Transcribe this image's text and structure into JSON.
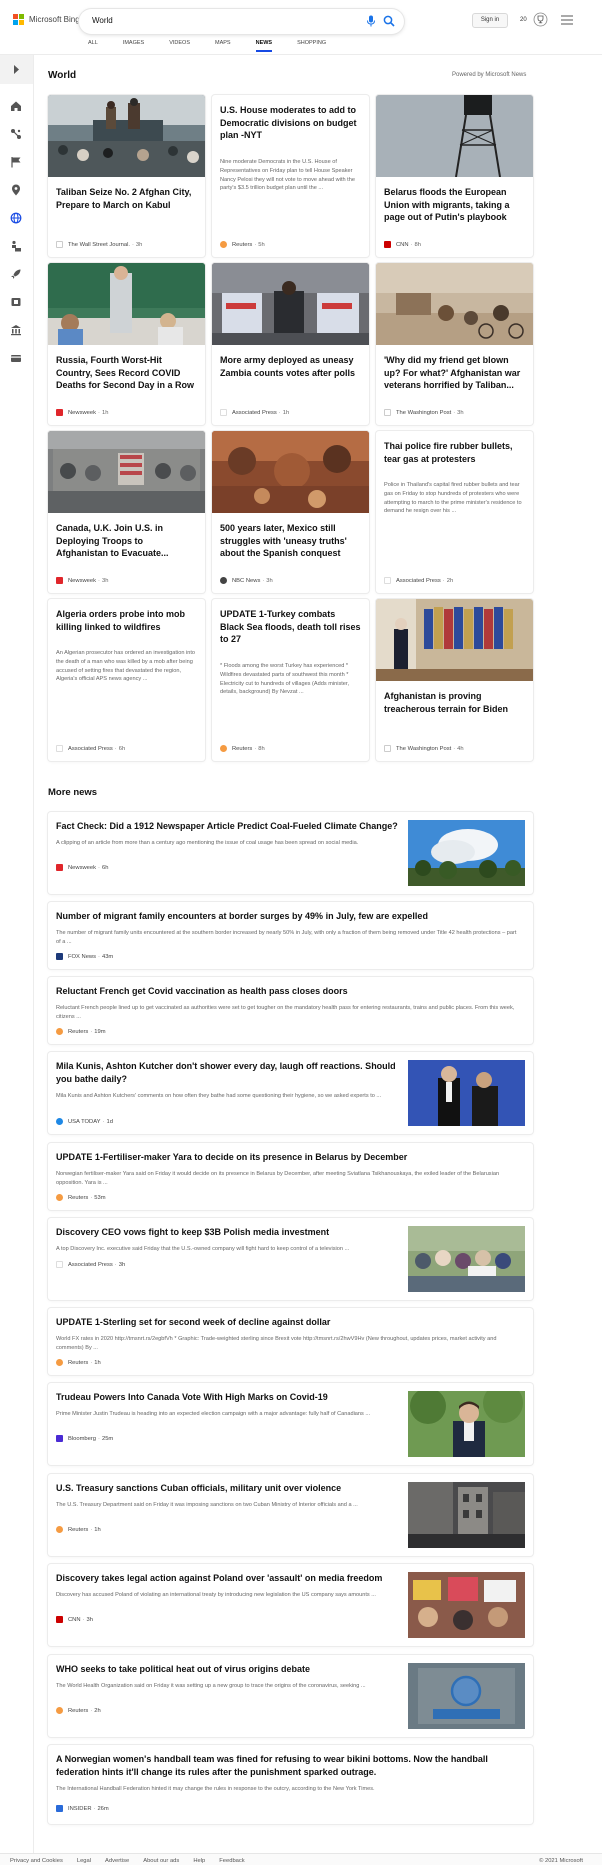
{
  "header": {
    "logo_text": "Microsoft Bing",
    "search_value": "World",
    "signin_label": "Sign in",
    "rewards_count": "20",
    "tabs": [
      {
        "label": "ALL"
      },
      {
        "label": "IMAGES"
      },
      {
        "label": "VIDEOS"
      },
      {
        "label": "MAPS"
      },
      {
        "label": "NEWS"
      },
      {
        "label": "SHOPPING"
      }
    ],
    "active_tab": "NEWS"
  },
  "world": {
    "title": "World",
    "powered_by": "Powered by Microsoft News",
    "cards": [
      {
        "title": "Taliban Seize No. 2 Afghan City, Prepare to March on Kabul",
        "source": "The Wall Street Journal.",
        "time": "3h"
      },
      {
        "title": "U.S. House moderates to add to Democratic divisions on budget plan -NYT",
        "snippet": "Nine moderate Democrats in the U.S. House of Representatives on Friday plan to tell House Speaker Nancy Pelosi they will not vote to move ahead with the party's $3.5 trillion budget plan until the ...",
        "source": "Reuters",
        "time": "5h"
      },
      {
        "title": "Belarus floods the European Union with migrants, taking a page out of Putin's playbook",
        "source": "CNN",
        "time": "8h"
      },
      {
        "title": "Russia, Fourth Worst-Hit Country, Sees Record COVID Deaths for Second Day in a Row",
        "source": "Newsweek",
        "time": "1h"
      },
      {
        "title": "More army deployed as uneasy Zambia counts votes after polls",
        "source": "Associated Press",
        "time": "1h"
      },
      {
        "title": "'Why did my friend get blown up? For what?' Afghanistan war veterans horrified by Taliban...",
        "source": "The Washington Post",
        "time": "3h"
      },
      {
        "title": "Canada, U.K. Join U.S. in Deploying Troops to Afghanistan to Evacuate...",
        "source": "Newsweek",
        "time": "3h"
      },
      {
        "title": "500 years later, Mexico still struggles with 'uneasy truths' about the Spanish conquest",
        "source": "NBC News",
        "time": "3h"
      },
      {
        "title": "Thai police fire rubber bullets, tear gas at protesters",
        "snippet": "Police in Thailand's capital fired rubber bullets and tear gas on Friday to stop hundreds of protesters who were attempting to march to the prime minister's residence to demand he resign over his ...",
        "source": "Associated Press",
        "time": "2h"
      },
      {
        "title": "Algeria orders probe into mob killing linked to wildfires",
        "snippet": "An Algerian prosecutor has ordered an investigation into the death of a man who was killed by a mob after being accused of setting fires that devastated the region, Algeria's official APS news agency ...",
        "source": "Associated Press",
        "time": "6h"
      },
      {
        "title": "UPDATE 1-Turkey combats Black Sea floods, death toll rises to 27",
        "snippet": "* Floods among the worst Turkey has experienced * Wildfires devastated parts of southwest this month * Electricity cut to hundreds of villages (Adds minister, details, background) By Nevzat ...",
        "source": "Reuters",
        "time": "8h"
      },
      {
        "title": "Afghanistan is proving treacherous terrain for Biden",
        "source": "The Washington Post",
        "time": "4h"
      }
    ]
  },
  "more_news": {
    "title": "More news",
    "items": [
      {
        "title": "Fact Check: Did a 1912 Newspaper Article Predict Coal-Fueled Climate Change?",
        "snippet": "A clipping of an article from more than a century ago mentioning the issue of coal usage has been spread on social media.",
        "source": "Newsweek",
        "time": "6h"
      },
      {
        "title": "Number of migrant family encounters at border surges by 49% in July, few are expelled",
        "snippet": "The number of migrant family units encountered at the southern border increased by nearly 50% in July, with only a fraction of them being removed under Title 42 health protections – part of a ...",
        "source": "FOX News",
        "time": "43m"
      },
      {
        "title": "Reluctant French get Covid vaccination as health pass closes doors",
        "snippet": "Reluctant French people lined up to get vaccinated as authorities were set to get tougher on the mandatory health pass for entering restaurants, trains and public places. From this week, citizens ...",
        "source": "Reuters",
        "time": "19m"
      },
      {
        "title": "Mila Kunis, Ashton Kutcher don't shower every day, laugh off reactions. Should you bathe daily?",
        "snippet": "Mila Kunis and Ashton Kutchers' comments on how often they bathe had some questioning their hygiene, so we asked experts to ...",
        "source": "USA TODAY",
        "time": "1d"
      },
      {
        "title": "UPDATE 1-Fertiliser-maker Yara to decide on its presence in Belarus by December",
        "snippet": "Norwegian fertiliser-maker Yara said on Friday it would decide on its presence in Belarus by December, after meeting Sviatlana Tsikhanouskaya, the exiled leader of the Belarusian opposition. Yara is ...",
        "source": "Reuters",
        "time": "53m"
      },
      {
        "title": "Discovery CEO vows fight to keep $3B Polish media investment",
        "snippet": "A top Discovery Inc. executive said Friday that the U.S.-owned company will fight hard to keep control of a television ...",
        "source": "Associated Press",
        "time": "3h"
      },
      {
        "title": "UPDATE 1-Sterling set for second week of decline against dollar",
        "snippet": "World FX rates in 2020 http://tmsnrt.rs/2egbfVh * Graphic: Trade-weighted sterling since Brexit vote http://tmsnrt.rs/2hwV9Hv (New throughout, updates prices, market activity and comments) By ...",
        "source": "Reuters",
        "time": "1h"
      },
      {
        "title": "Trudeau Powers Into Canada Vote With High Marks on Covid-19",
        "snippet": "Prime Minister Justin Trudeau is heading into an expected election campaign with a major advantage: fully half of Canadians ...",
        "source": "Bloomberg",
        "time": "25m"
      },
      {
        "title": "U.S. Treasury sanctions Cuban officials, military unit over violence",
        "snippet": "The U.S. Treasury Department said on Friday it was imposing sanctions on two Cuban Ministry of Interior officials and a ...",
        "source": "Reuters",
        "time": "1h"
      },
      {
        "title": "Discovery takes legal action against Poland over 'assault' on media freedom",
        "snippet": "Discovery has accused Poland of violating an international treaty by introducing new legislation the US company says amounts ...",
        "source": "CNN",
        "time": "3h"
      },
      {
        "title": "WHO seeks to take political heat out of virus origins debate",
        "snippet": "The World Health Organization said on Friday it was setting up a new group to trace the origins of the coronavirus, seeking ...",
        "source": "Reuters",
        "time": "2h"
      },
      {
        "title": "A Norwegian women's handball team was fined for refusing to wear bikini bottoms. Now the handball federation hints it'll change its rules after the punishment sparked outrage.",
        "snippet": "The International Handball Federation hinted it may change the rules in response to the outcry, according to the New York Times.",
        "source": "INSIDER",
        "time": "26m"
      }
    ]
  },
  "footer": {
    "links": [
      "Privacy and Cookies",
      "Legal",
      "Advertise",
      "About our ads",
      "Help",
      "Feedback"
    ],
    "copyright": "© 2021 Microsoft"
  },
  "colors": {
    "accent": "#174ae4",
    "search_icon": "#1a73e8"
  }
}
